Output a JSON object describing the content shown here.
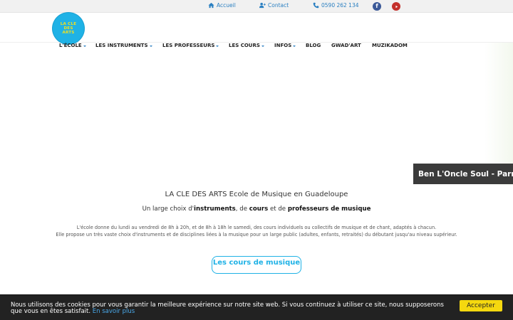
{
  "topbar": {
    "home_label": "Accueil",
    "contact_label": "Contact",
    "phone": "0590 262 134"
  },
  "logo": {
    "line1": "LA CLE",
    "line2": "DES",
    "line3": "ARTS"
  },
  "nav": {
    "items": [
      {
        "label": "L'ÉCOLE",
        "has_caret": true
      },
      {
        "label": "LES INSTRUMENTS",
        "has_caret": true
      },
      {
        "label": "LES PROFESSEURS",
        "has_caret": true
      },
      {
        "label": "LES COURS",
        "has_caret": true
      },
      {
        "label": "INFOS",
        "has_caret": true
      },
      {
        "label": "BLOG",
        "has_caret": false
      },
      {
        "label": "GWAD'ART",
        "has_caret": false
      },
      {
        "label": "MUZIKADOM",
        "has_caret": false
      }
    ]
  },
  "banner": {
    "video_title": "Ben L'Oncle Soul - Parr"
  },
  "content": {
    "title": "LA CLE DES ARTS Ecole de Musique en Guadeloupe",
    "subtitle_p1": "Un large choix d'",
    "subtitle_b1": "instruments",
    "subtitle_p2": ", de ",
    "subtitle_b2": "cours",
    "subtitle_p3": " et de ",
    "subtitle_b3": "professeurs de musique",
    "desc_line1": "L'école donne du lundi au vendredi de 8h à 20h, et de 8h à 18h le samedi, des cours individuels ou collectifs de musique et de chant, adaptés à chacun.",
    "desc_line2": "Elle propose un très vaste choix d'instruments et de disciplines liées à la musique pour un large public (adultes, enfants, retraités) du débutant jusqu'au niveau supérieur.",
    "cta_label": "Les cours de musique"
  },
  "cookie": {
    "text": "Nous utilisons des cookies pour vous garantir la meilleure expérience sur notre site web. Si vous continuez à utiliser ce site, nous supposerons que vous en êtes satisfait.",
    "link_label": "En savoir plus",
    "accept_label": "Accepter"
  },
  "colors": {
    "accent": "#1fb2e6",
    "link": "#2a7fc1",
    "cookie_bg": "#222222",
    "accept_bg": "#f5d80f"
  }
}
